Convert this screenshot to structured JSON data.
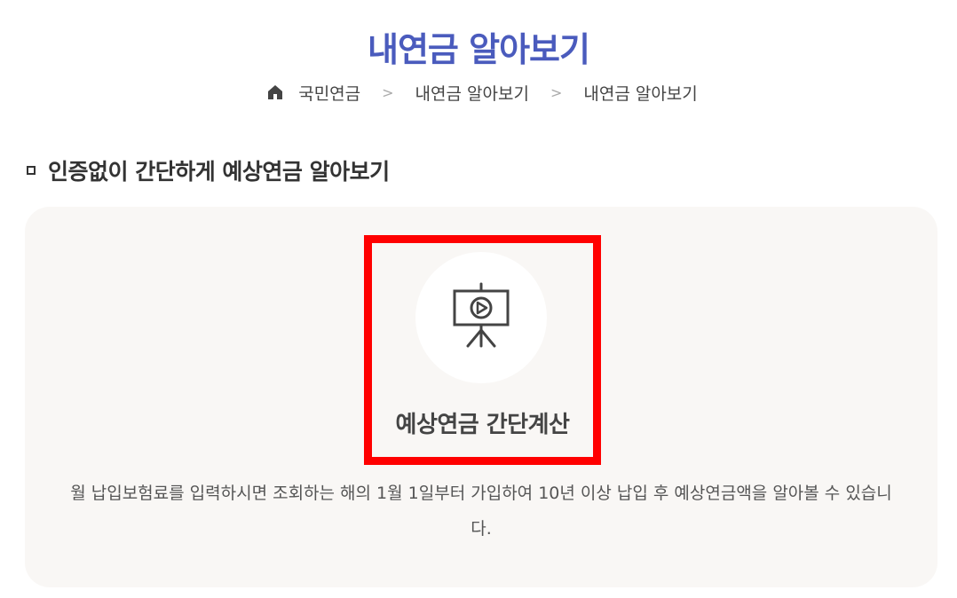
{
  "header": {
    "title": "내연금 알아보기"
  },
  "breadcrumb": {
    "home_icon": "home-icon",
    "items": [
      "국민연금",
      "내연금 알아보기",
      "내연금 알아보기"
    ],
    "separator": ">"
  },
  "section": {
    "heading": "인증없이 간단하게 예상연금 알아보기"
  },
  "card": {
    "icon": "presentation-play-icon",
    "link_label": "예상연금 간단계산",
    "description": "월 납입보험료를 입력하시면 조회하는 해의 1월 1일부터 가입하여 10년 이상 납입 후 예상연금액을 알아볼 수 있습니다."
  },
  "colors": {
    "title": "#4a5bbd",
    "card_background": "#f9f7f5",
    "highlight_border": "#ff0000"
  }
}
